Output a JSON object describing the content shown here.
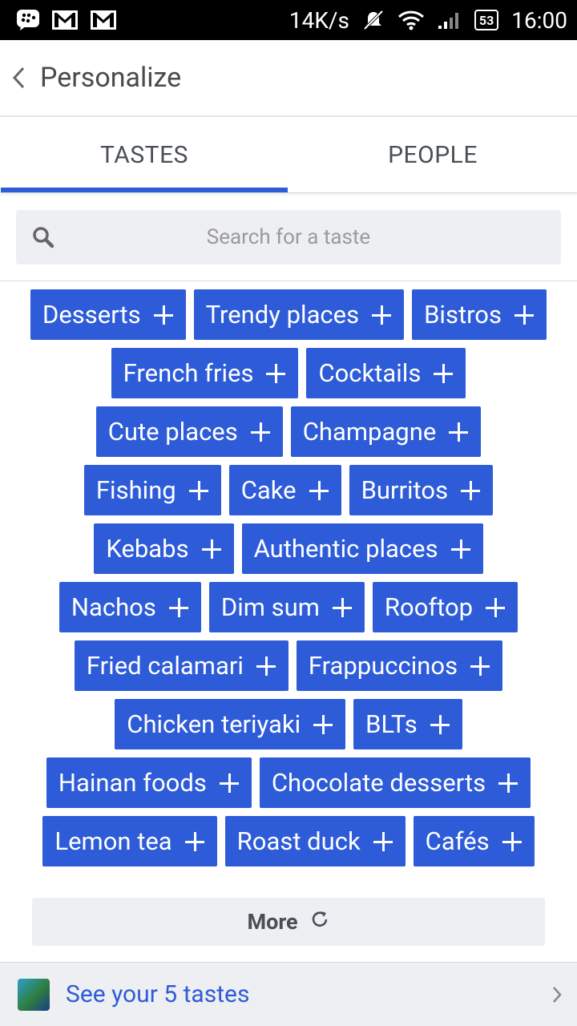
{
  "status_bar": {
    "speed": "14K/s",
    "battery": "53",
    "time": "16:00",
    "icons": [
      "bbm-icon",
      "gmail-icon",
      "gmail-icon",
      "mute-icon",
      "wifi-icon",
      "signal-icon",
      "battery-icon"
    ]
  },
  "header": {
    "title": "Personalize"
  },
  "tabs": [
    {
      "label": "TASTES",
      "active": true
    },
    {
      "label": "PEOPLE",
      "active": false
    }
  ],
  "search": {
    "placeholder": "Search for a taste"
  },
  "chip_rows": [
    [
      "Desserts",
      "Trendy places",
      "Bistros"
    ],
    [
      "French fries",
      "Cocktails"
    ],
    [
      "Cute places",
      "Champagne"
    ],
    [
      "Fishing",
      "Cake",
      "Burritos"
    ],
    [
      "Kebabs",
      "Authentic places"
    ],
    [
      "Nachos",
      "Dim sum",
      "Rooftop"
    ],
    [
      "Fried calamari",
      "Frappuccinos"
    ],
    [
      "Chicken teriyaki",
      "BLTs"
    ],
    [
      "Hainan foods",
      "Chocolate desserts"
    ],
    [
      "Lemon tea",
      "Roast duck",
      "Cafés"
    ]
  ],
  "more_button": {
    "label": "More"
  },
  "footer": {
    "text": "See your 5 tastes"
  },
  "colors": {
    "accent": "#2e5cd8",
    "chip_bg": "#2e5cd8",
    "surface": "#eeeff2"
  }
}
